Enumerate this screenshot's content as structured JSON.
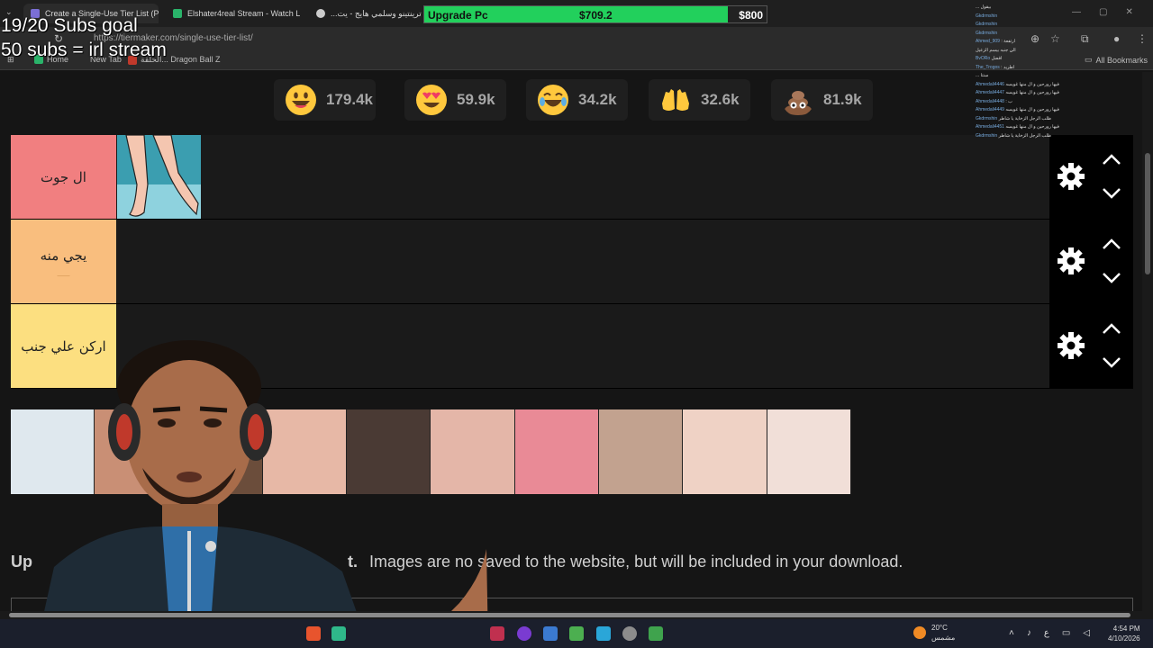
{
  "browser": {
    "tabs": [
      {
        "title": "Create a Single-Use Tier List (P",
        "active": true,
        "color": "#7b6fd6"
      },
      {
        "title": "Elshater4real Stream - Watch L",
        "active": false,
        "color": "#2ab36a"
      },
      {
        "title": "...تين ترينتينو وسلمي هايج - يت",
        "active": false,
        "color": "#cccccc"
      }
    ],
    "url": "https://tiermaker.com/single-use-tier-list/",
    "bookmarks": [
      {
        "label": "Home",
        "color": "#2ab36a"
      },
      {
        "label": "New Tab",
        "color": "#666666"
      },
      {
        "label": "الحلقة... Dragon Ball Z",
        "color": "#c0392b"
      }
    ],
    "all_bookmarks": "All Bookmarks"
  },
  "overlay": {
    "subs_goal": "19/20 Subs goal",
    "subs_promise": "50 subs = irl stream",
    "upgrade": {
      "label": "Upgrade Pc",
      "current": "$709.2",
      "goal": "$800",
      "progress": 0.8865,
      "color": "#22d05c"
    }
  },
  "reactions": [
    {
      "emoji": "smile-emoji",
      "count": "179.4k"
    },
    {
      "emoji": "heart-eyes-emoji",
      "count": "59.9k"
    },
    {
      "emoji": "laughing-emoji",
      "count": "34.2k"
    },
    {
      "emoji": "raised-hands-emoji",
      "count": "32.6k"
    },
    {
      "emoji": "poo-emoji",
      "count": "81.9k"
    }
  ],
  "tiers": [
    {
      "label": "ال جوت",
      "color": "#f17f80",
      "has_item": true
    },
    {
      "label": "يجي منه",
      "sublabel": "____",
      "color": "#f9be7e",
      "has_item": false
    },
    {
      "label": "اركن علي جنب",
      "color": "#fcdf80",
      "has_item": false
    }
  ],
  "pool": {
    "items": [
      {
        "name": "cartoon-image",
        "color": "#dfe8ee"
      },
      {
        "name": "woman-image",
        "color": "#c98f75"
      },
      {
        "name": "hair-image",
        "color": "#6b4d3b"
      },
      {
        "name": "nose-image",
        "color": "#e7b8a6"
      },
      {
        "name": "portrait-image",
        "color": "#4a3a34"
      },
      {
        "name": "knees-image",
        "color": "#e4b6a8"
      },
      {
        "name": "lips-image",
        "color": "#e98a96"
      },
      {
        "name": "brain-image",
        "color": "#c2a28f"
      },
      {
        "name": "armpit-image",
        "color": "#efd2c5"
      },
      {
        "name": "hand-image",
        "color": "#f1dfd8"
      }
    ]
  },
  "upload": {
    "prefix": "Up",
    "dot": "t.",
    "text": "Images are no   saved to the website, but will be included in your download."
  },
  "chat": [
    {
      "user": "",
      "text": "... بيقول"
    },
    {
      "user": "Gkdrmshin",
      "text": ""
    },
    {
      "user": "Gkdrmshin",
      "text": ""
    },
    {
      "user": "Gkdrmshin",
      "text": ""
    },
    {
      "user": "Ahmed_909",
      "text": ": ارتفعة"
    },
    {
      "user": "",
      "text": "الي جنبه بيسم الزعيل"
    },
    {
      "user": "",
      "text": ""
    },
    {
      "user": "BvORo",
      "text": "افضل"
    },
    {
      "user": "The_Trogos",
      "text": ": اطريد"
    },
    {
      "user": "",
      "text": "... سنتا"
    },
    {
      "user": "Ahmedali4446",
      "text": "فيها رورحين و ال منها غويسه"
    },
    {
      "user": "Ahmedali4447",
      "text": "فيها رورحين و ال منها غويسه"
    },
    {
      "user": "Ahmedali4448",
      "text": ": ب"
    },
    {
      "user": "Ahmedali4449",
      "text": "فيها رورحين و ال منها غويسه"
    },
    {
      "user": "Gkdrmshin",
      "text": "ظلب الرجل الزخاية يا شاطر"
    },
    {
      "user": "Ahmedali4451",
      "text": "فيها رورحين و ال منها غويسه"
    },
    {
      "user": "Gkdrmshin",
      "text": "ظلب الرجل الزخاية يا شاطر"
    }
  ],
  "taskbar": {
    "weather_temp": "20°C",
    "weather_desc": "مشمس",
    "time": "4:54 PM",
    "date": "4/10/2026",
    "lang": "ع"
  }
}
